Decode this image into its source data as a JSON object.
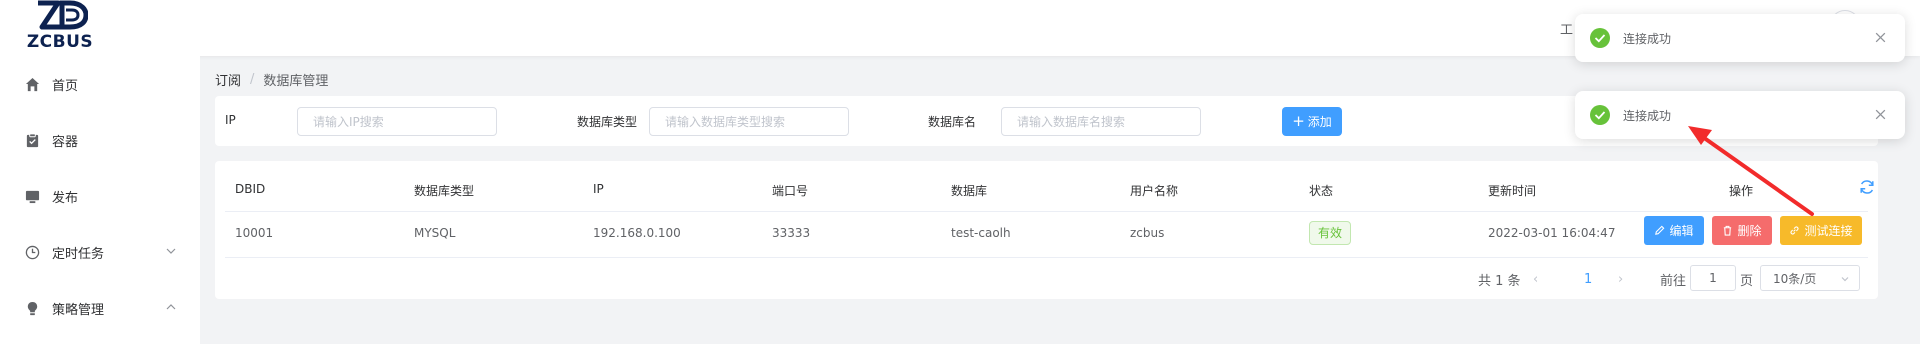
{
  "header": {
    "logo_text": "ZCBUS",
    "tool_text": "工"
  },
  "sidebar": {
    "items": [
      {
        "label": "首页",
        "icon": "home-icon"
      },
      {
        "label": "容器",
        "icon": "clipboard-icon"
      },
      {
        "label": "发布",
        "icon": "monitor-icon"
      },
      {
        "label": "定时任务",
        "icon": "clock-icon",
        "expanded": false
      },
      {
        "label": "策略管理",
        "icon": "bulb-icon",
        "expanded": true
      }
    ]
  },
  "breadcrumb": {
    "parent": "订阅",
    "separator": "/",
    "current": "数据库管理"
  },
  "filters": {
    "ip_label": "IP",
    "ip_placeholder": "请输入IP搜索",
    "type_label": "数据库类型",
    "type_placeholder": "请输入数据库类型搜索",
    "name_label": "数据库名",
    "name_placeholder": "请输入数据库名搜索",
    "add_label": "添加"
  },
  "table": {
    "columns": [
      "DBID",
      "数据库类型",
      "IP",
      "端口号",
      "数据库",
      "用户名称",
      "状态",
      "更新时间",
      "操作"
    ],
    "rows": [
      {
        "dbid": "10001",
        "type": "MYSQL",
        "ip": "192.168.0.100",
        "port": "33333",
        "database": "test-caolh",
        "user": "zcbus",
        "status": "有效",
        "updated": "2022-03-01 16:04:47"
      }
    ],
    "actions": {
      "edit": "编辑",
      "delete": "删除",
      "test": "测试连接"
    }
  },
  "pagination": {
    "total": "共 1 条",
    "prev": "‹",
    "page": "1",
    "next": "›",
    "goto_label": "前往",
    "goto_value": "1",
    "page_label": "页",
    "page_size": "10条/页"
  },
  "toasts": [
    {
      "message": "连接成功",
      "type": "success"
    },
    {
      "message": "连接成功",
      "type": "success"
    }
  ],
  "colors": {
    "primary": "#409eff",
    "danger": "#f56c6c",
    "warning": "#f7ba2a",
    "success": "#67c23a",
    "annotation": "#f22b2b",
    "logo": "#0d2250"
  }
}
